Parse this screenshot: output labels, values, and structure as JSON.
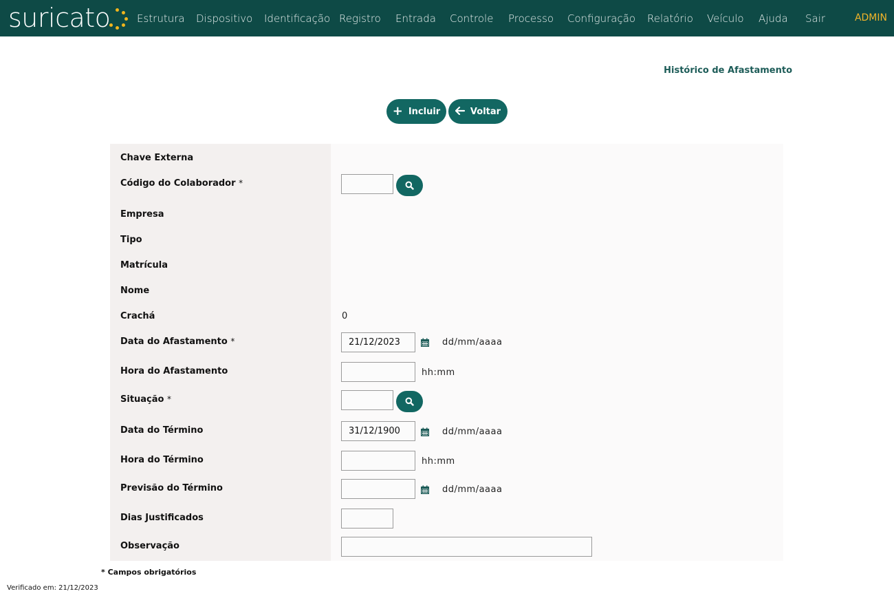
{
  "brand": {
    "name": "suricato",
    "dot_color": "#f1b51c",
    "bar_color": "#0e4a46"
  },
  "nav": {
    "items": [
      "Estrutura",
      "Dispositivo",
      "Identificação",
      "Registro",
      "Entrada",
      "Controle",
      "Processo",
      "Configuração",
      "Relatório",
      "Veículo",
      "Ajuda",
      "Sair"
    ],
    "user": "ADMIN"
  },
  "page": {
    "title": "Histórico de Afastamento"
  },
  "actions": {
    "include_label": "Incluir",
    "back_label": "Voltar",
    "button_color": "#126762"
  },
  "form": {
    "required_mark": "*",
    "labels": {
      "chave_externa": "Chave Externa",
      "codigo_colaborador": "Código do Colaborador",
      "empresa": "Empresa",
      "tipo": "Tipo",
      "matricula": "Matrícula",
      "nome": "Nome",
      "cracha": "Crachá",
      "data_afastamento": "Data do Afastamento",
      "hora_afastamento": "Hora do Afastamento",
      "situacao": "Situação",
      "data_termino": "Data do Término",
      "hora_termino": "Hora do Término",
      "previsao_termino": "Previsão do Término",
      "dias_justificados": "Dias Justificados",
      "observacao": "Observação"
    },
    "values": {
      "cracha": "0",
      "data_afastamento": "21/12/2023",
      "data_termino": "31/12/1900"
    },
    "hints": {
      "date": "dd/mm/aaaa",
      "time": "hh:mm"
    }
  },
  "footer": {
    "required_note": "* Campos obrigatórios",
    "verified": "Verificado em: 21/12/2023"
  }
}
